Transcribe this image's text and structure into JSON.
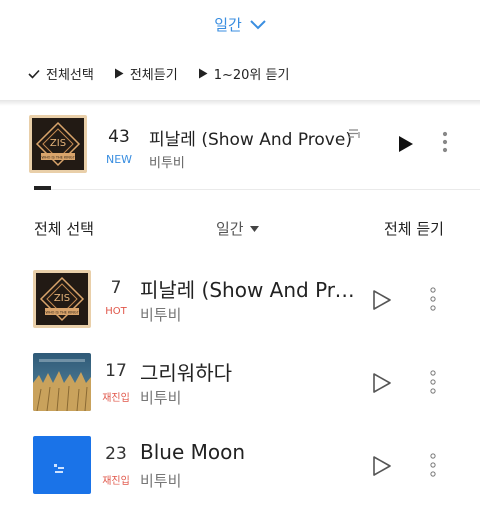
{
  "top_period": {
    "label": "일간",
    "icon": "chevron-down-icon"
  },
  "actions": {
    "select_all": "전체선택",
    "play_all": "전체듣기",
    "play_range": "1~20위 듣기"
  },
  "now_playing": {
    "rank": "43",
    "badge": "NEW",
    "title": "피날레 (Show And Prove)",
    "artist": "비투비",
    "cover_text": {
      "logo": "ZIS",
      "banner": "WHO IS THE KING?"
    }
  },
  "list_header": {
    "select_all": "전체 선택",
    "period": "일간",
    "play_all": "전체 듣기"
  },
  "songs": [
    {
      "rank": "7",
      "badge": "HOT",
      "title": "피날레 (Show And Pro…",
      "artist": "비투비",
      "cover": "zis"
    },
    {
      "rank": "17",
      "badge": "재진입",
      "title": "그리워하다",
      "artist": "비투비",
      "cover": "field"
    },
    {
      "rank": "23",
      "badge": "재진입",
      "title": "Blue Moon",
      "artist": "비투비",
      "cover": "blue"
    }
  ],
  "colors": {
    "accent_blue": "#3a8ee0",
    "badge_red": "#e0574a",
    "cover_blue": "#1a73e8"
  }
}
